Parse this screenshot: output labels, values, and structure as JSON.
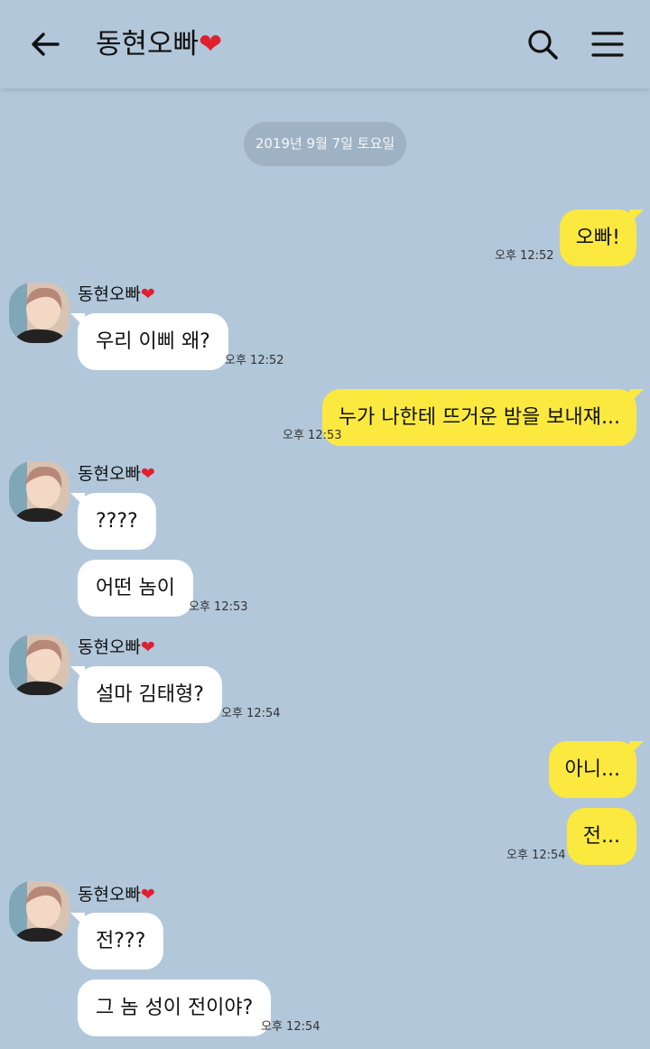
{
  "header": {
    "back_icon": "back-arrow-icon",
    "title": "동현오빠",
    "title_heart": "❤",
    "search_icon": "search-icon",
    "menu_icon": "menu-icon"
  },
  "date_divider": "2019년 9월 7일 토요일",
  "contact": {
    "name": "동현오빠",
    "heart": "❤"
  },
  "messages": [
    {
      "from": "me",
      "text": "오빠!",
      "time": "오후 12:52"
    },
    {
      "from": "contact",
      "text": "우리 이삐 왜?",
      "time": "오후 12:52"
    },
    {
      "from": "me",
      "text": "누가 나한테 뜨거운 밤을 보내쟤...",
      "time": "오후 12:53"
    },
    {
      "from": "contact",
      "text": "????"
    },
    {
      "from": "contact",
      "text": "어떤 놈이",
      "time": "오후 12:53"
    },
    {
      "from": "contact",
      "text": "설마 김태형?",
      "time": "오후 12:54"
    },
    {
      "from": "me",
      "text": "아니..."
    },
    {
      "from": "me",
      "text": "전...",
      "time": "오후 12:54"
    },
    {
      "from": "contact",
      "text": "전???"
    },
    {
      "from": "contact",
      "text": "그 놈 성이 전이야?",
      "time": "오후 12:54"
    }
  ],
  "colors": {
    "background": "#b2c7da",
    "outgoing_bubble": "#fbe940",
    "incoming_bubble": "#ffffff",
    "date_pill": "#9fb2c3",
    "heart": "#e0202e"
  }
}
